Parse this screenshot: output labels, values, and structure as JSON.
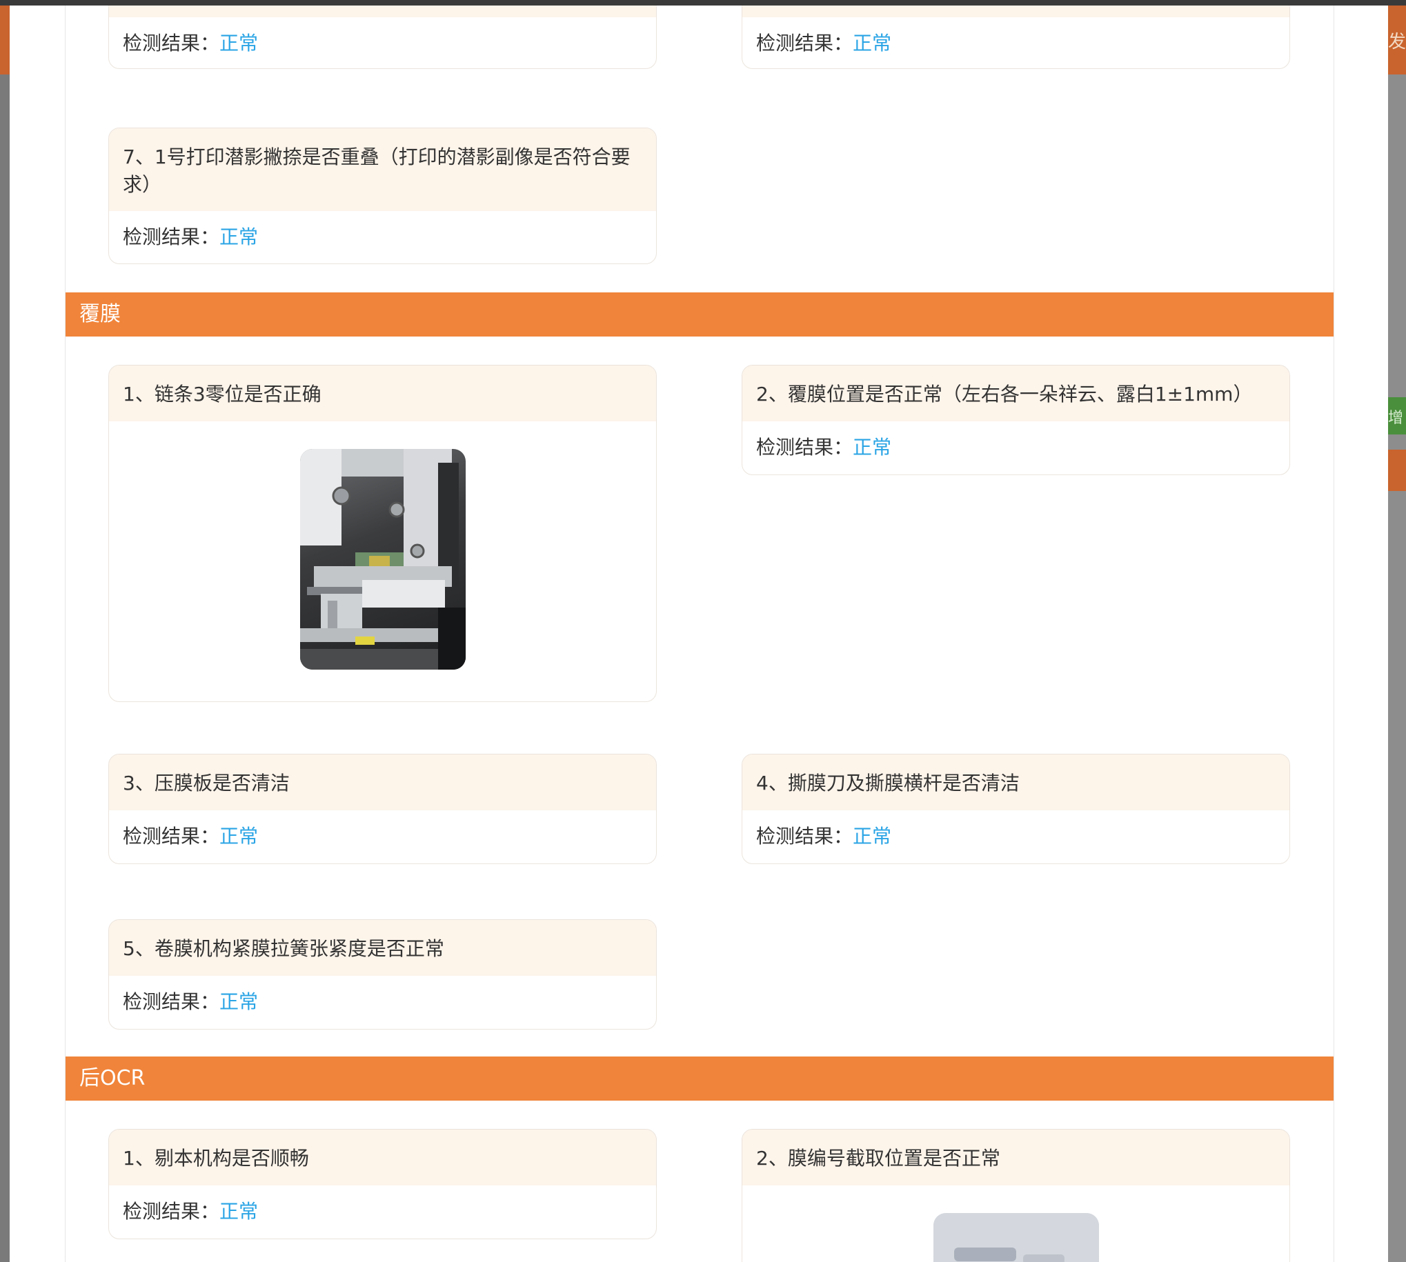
{
  "background": {
    "left_glyph": "·",
    "right_glyphs": [
      "发",
      "增"
    ]
  },
  "labels": {
    "result_label": "检测结果："
  },
  "top_partial": [
    {
      "result": "正常"
    },
    {
      "result": "正常"
    }
  ],
  "print_item7": {
    "title": "7、1号打印潜影撇捺是否重叠（打印的潜影副像是否符合要求）",
    "result": "正常"
  },
  "sections": [
    {
      "title": "覆膜",
      "items": [
        {
          "title": "1、链条3零位是否正确",
          "image": "machine-photo"
        },
        {
          "title": "2、覆膜位置是否正常（左右各一朵祥云、露白1±1mm）",
          "result": "正常"
        },
        {
          "title": "3、压膜板是否清洁",
          "result": "正常"
        },
        {
          "title": "4、撕膜刀及撕膜横杆是否清洁",
          "result": "正常"
        },
        {
          "title": "5、卷膜机构紧膜拉簧张紧度是否正常",
          "result": "正常"
        }
      ]
    },
    {
      "title": "后OCR",
      "items": [
        {
          "title": "1、剔本机构是否顺畅",
          "result": "正常"
        },
        {
          "title": "2、膜编号截取位置是否正常",
          "image": "film-number-photo"
        }
      ]
    }
  ],
  "colors": {
    "accent_orange": "#f0843a",
    "result_blue": "#2aa4e5",
    "card_head_bg": "#fdf4ea"
  }
}
